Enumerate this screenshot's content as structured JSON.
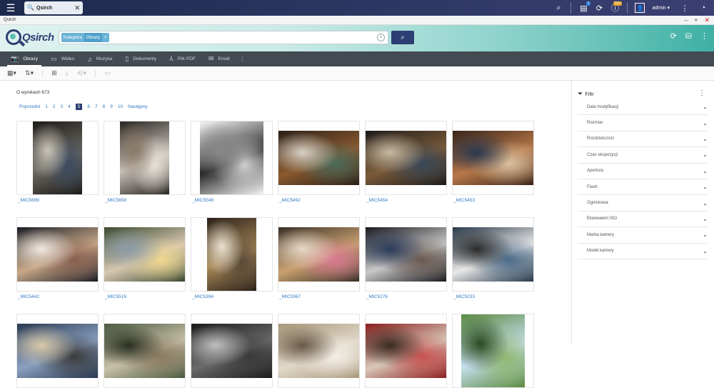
{
  "osbar": {
    "tab_title": "Qsirch",
    "user": "admin ▾",
    "badge_tasks": "1",
    "badge_info": "10+",
    "colors": {
      "background": "#27355e",
      "badge_tasks": "#2f7dd6",
      "badge_info": "#e5a126"
    }
  },
  "app": {
    "window_title": "Qsirch",
    "logo_text": "Qsirch"
  },
  "search": {
    "chip_key": "Kategoria",
    "chip_value": "Obrazy",
    "chip_remove": "×",
    "query": "",
    "button_icon": "search-icon"
  },
  "tabs": [
    {
      "label": "Obrazy",
      "icon": "camera-icon",
      "active": true
    },
    {
      "label": "Wideo",
      "icon": "film-icon",
      "active": false
    },
    {
      "label": "Muzyka",
      "icon": "music-icon",
      "active": false
    },
    {
      "label": "Dokumenty",
      "icon": "document-icon",
      "active": false
    },
    {
      "label": "Plik PDF",
      "icon": "pdf-icon",
      "active": false
    },
    {
      "label": "Email",
      "icon": "mail-icon",
      "active": false
    }
  ],
  "results": {
    "count_text": "O wynikach 673"
  },
  "pager": {
    "prev": "Poprzedni",
    "pages": [
      "1",
      "2",
      "3",
      "4",
      "5",
      "6",
      "7",
      "8",
      "9",
      "10"
    ],
    "current": "5",
    "next": "Następny"
  },
  "items": [
    {
      "name": "_MIC5699",
      "orientation": "port",
      "palette": [
        "#1c1a18",
        "#6e6a62",
        "#c9c4b8",
        "#3a4a60"
      ]
    },
    {
      "name": "_MIC5658",
      "orientation": "port",
      "palette": [
        "#2a2622",
        "#c8c2ba",
        "#8a7a66",
        "#e6e0d8"
      ]
    },
    {
      "name": "_MIC5548",
      "orientation": "portw",
      "palette": [
        "#f4f4f4",
        "#2a2a2a",
        "#888888",
        "#cfcfcf"
      ]
    },
    {
      "name": "_MIC5492",
      "orientation": "land",
      "palette": [
        "#2a1e16",
        "#8a5a30",
        "#d8d0c4",
        "#4a6a5a"
      ]
    },
    {
      "name": "_MIC5454",
      "orientation": "land",
      "palette": [
        "#1e1a18",
        "#7a5a3a",
        "#c8b8a0",
        "#384858"
      ]
    },
    {
      "name": "_MIC5453",
      "orientation": "land",
      "palette": [
        "#3a2418",
        "#b87848",
        "#2a3850",
        "#d8c0a0"
      ]
    },
    {
      "name": "_MIC5442",
      "orientation": "land",
      "palette": [
        "#1a1e26",
        "#c8a888",
        "#f0e8e0",
        "#8a6050"
      ]
    },
    {
      "name": "_MIC5516",
      "orientation": "land",
      "palette": [
        "#3a4a30",
        "#d8c8b0",
        "#8a9aa8",
        "#f0d890"
      ]
    },
    {
      "name": "_MIC5394",
      "orientation": "port",
      "palette": [
        "#2a2018",
        "#a88858",
        "#e8e0d0",
        "#5a4a38"
      ]
    },
    {
      "name": "_MIC5367",
      "orientation": "land",
      "palette": [
        "#3a3028",
        "#c8a070",
        "#e8d8c8",
        "#d87890"
      ]
    },
    {
      "name": "_MIC5276",
      "orientation": "land",
      "palette": [
        "#1a1a20",
        "#c8c8c8",
        "#2a3a58",
        "#6a5a50"
      ]
    },
    {
      "name": "_MIC5233",
      "orientation": "land",
      "palette": [
        "#283848",
        "#e8e8e8",
        "#2a2a2a",
        "#4a6a88"
      ]
    },
    {
      "name": "",
      "orientation": "land",
      "palette": [
        "#283850",
        "#8aa0c0",
        "#d8c8a8",
        "#3a3a3a"
      ]
    },
    {
      "name": "",
      "orientation": "land",
      "palette": [
        "#4a5a40",
        "#c8c0a8",
        "#2a3020",
        "#8a7a60"
      ]
    },
    {
      "name": "",
      "orientation": "land",
      "palette": [
        "#1a1a1a",
        "#6a6a6a",
        "#bfbfbf",
        "#3a3a3a"
      ]
    },
    {
      "name": "",
      "orientation": "land",
      "palette": [
        "#a8987a",
        "#e0d8c8",
        "#6a5a48",
        "#f4efe6"
      ]
    },
    {
      "name": "",
      "orientation": "land",
      "palette": [
        "#8a1e1e",
        "#d8c8b8",
        "#3a2a20",
        "#c85050"
      ]
    },
    {
      "name": "",
      "orientation": "portw",
      "palette": [
        "#5a8a40",
        "#c8e0f0",
        "#2a4a20",
        "#90b870"
      ]
    }
  ],
  "filter": {
    "title": "Filtr",
    "items": [
      "Data modyfikacji",
      "Rozmiar",
      "Rozdzielczość",
      "Czas ekspozycji",
      "Apertura",
      "Flash",
      "Ogniskowa",
      "Ekwiwalent ISO",
      "Marka kamery",
      "Model kamery"
    ]
  }
}
